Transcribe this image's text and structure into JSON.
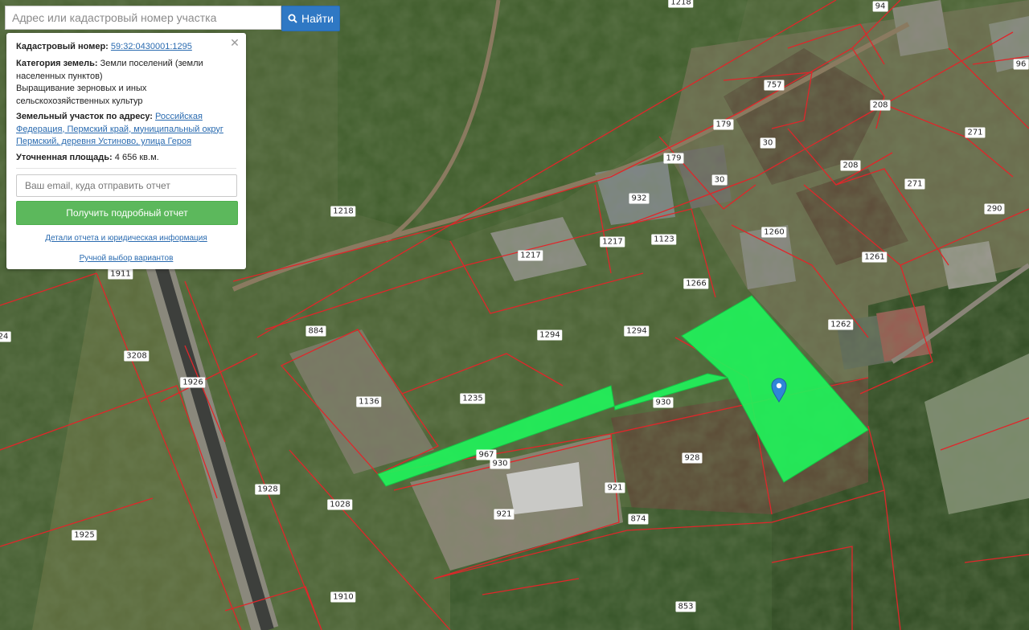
{
  "search": {
    "placeholder": "Адрес или кадастровый номер участка",
    "button_label": "Найти",
    "button_icon": "search-icon"
  },
  "info_panel": {
    "cadastral_label": "Кадастровый номер:",
    "cadastral_number": "59:32:0430001:1295",
    "category_label": "Категория земель:",
    "category_value": "Земли поселений (земли населенных пунктов)",
    "usage_value": "Выращивание зерновых и иных сельскохозяйственных культур",
    "address_label": "Земельный участок по адресу:",
    "address_value": "Российская Федерация, Пермский край, муниципальный округ Пермский, деревня Устиново, улица Героя",
    "area_label": "Уточненная площадь:",
    "area_value": "4 656 кв.м.",
    "email_placeholder": "Ваш email, куда отправить отчет",
    "report_button": "Получить подробный отчет",
    "details_link": "Детали отчета и юридическая информация",
    "manual_link": "Ручной выбор вариантов",
    "close_icon": "close-icon"
  },
  "map": {
    "boundary_color": "#e0262a",
    "highlight_color": "#21f25a",
    "marker_color": "#2f86d6",
    "parcel_labels": [
      "1218",
      "94",
      "757",
      "208",
      "96",
      "179",
      "30",
      "271",
      "179",
      "30",
      "208",
      "271",
      "290",
      "932",
      "1217",
      "1123",
      "1260",
      "1261",
      "1217",
      "1266",
      "1262",
      "1911",
      "884",
      "1294",
      "1294",
      "3208",
      "1136",
      "1235",
      "930",
      "1926",
      "967",
      "930",
      "928",
      "921",
      "1928",
      "921",
      "874",
      "1028",
      "1925",
      "1910",
      "853",
      "24",
      "1218"
    ]
  }
}
